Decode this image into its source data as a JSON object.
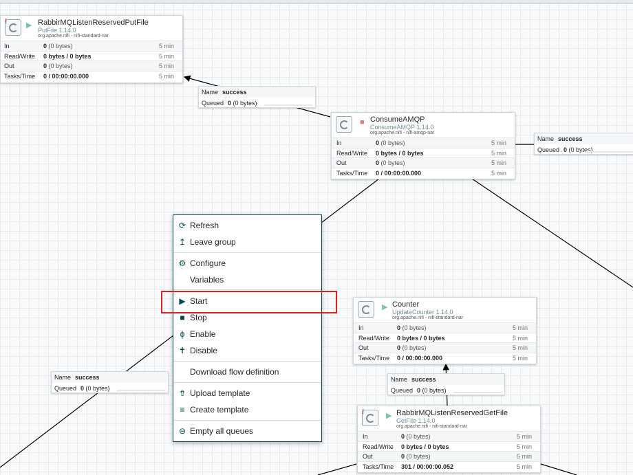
{
  "processors": {
    "putfile": {
      "name": "RabbirMQListenReservedPutFile",
      "type": "PutFile 1.14.0",
      "bundle": "org.apache.nifi - nifi-standard-nar",
      "state": "running",
      "rows": [
        {
          "label": "In",
          "value": "0",
          "unit": "(0 bytes)",
          "time": "5 min"
        },
        {
          "label": "Read/Write",
          "value": "0 bytes / 0 bytes",
          "unit": "",
          "time": "5 min"
        },
        {
          "label": "Out",
          "value": "0",
          "unit": "(0 bytes)",
          "time": "5 min"
        },
        {
          "label": "Tasks/Time",
          "value": "0 / 00:00:00.000",
          "unit": "",
          "time": "5 min"
        }
      ]
    },
    "consumeamqp": {
      "name": "ConsumeAMQP",
      "type": "ConsumeAMQP 1.14.0",
      "bundle": "org.apache.nifi - nifi-amqp-nar",
      "state": "stopped",
      "rows": [
        {
          "label": "In",
          "value": "0",
          "unit": "(0 bytes)",
          "time": "5 min"
        },
        {
          "label": "Read/Write",
          "value": "0 bytes / 0 bytes",
          "unit": "",
          "time": "5 min"
        },
        {
          "label": "Out",
          "value": "0",
          "unit": "(0 bytes)",
          "time": "5 min"
        },
        {
          "label": "Tasks/Time",
          "value": "0 / 00:00:00.000",
          "unit": "",
          "time": "5 min"
        }
      ]
    },
    "counter": {
      "name": "Counter",
      "type": "UpdateCounter 1.14.0",
      "bundle": "org.apache.nifi - nifi-standard-nar",
      "state": "running",
      "rows": [
        {
          "label": "In",
          "value": "0",
          "unit": "(0 bytes)",
          "time": "5 min"
        },
        {
          "label": "Read/Write",
          "value": "0 bytes / 0 bytes",
          "unit": "",
          "time": "5 min"
        },
        {
          "label": "Out",
          "value": "0",
          "unit": "(0 bytes)",
          "time": "5 min"
        },
        {
          "label": "Tasks/Time",
          "value": "0 / 00:00:00.000",
          "unit": "",
          "time": "5 min"
        }
      ]
    },
    "getfile": {
      "name": "RabbirMQListenReservedGetFile",
      "type": "GetFile 1.14.0",
      "bundle": "org.apache.nifi - nifi-standard-nar",
      "state": "running",
      "rows": [
        {
          "label": "In",
          "value": "0",
          "unit": "(0 bytes)",
          "time": "5 min"
        },
        {
          "label": "Read/Write",
          "value": "0 bytes / 0 bytes",
          "unit": "",
          "time": "5 min"
        },
        {
          "label": "Out",
          "value": "0",
          "unit": "(0 bytes)",
          "time": "5 min"
        },
        {
          "label": "Tasks/Time",
          "value": "301 / 00:00:00.052",
          "unit": "",
          "time": "5 min"
        }
      ]
    }
  },
  "connections": {
    "c1": {
      "name_label": "Name",
      "name": "success",
      "queued_label": "Queued",
      "queued": "0",
      "queued_unit": "(0 bytes)"
    },
    "c2": {
      "name_label": "Name",
      "name": "success",
      "queued_label": "Queued",
      "queued": "0",
      "queued_unit": "(0 bytes)"
    },
    "c3": {
      "name_label": "Name",
      "name": "success",
      "queued_label": "Queued",
      "queued": "0",
      "queued_unit": "(0 bytes)"
    },
    "c4": {
      "name_label": "Name",
      "name": "success",
      "queued_label": "Queued",
      "queued": "0",
      "queued_unit": "(0 bytes)"
    }
  },
  "context_menu": {
    "items": [
      {
        "label": "Refresh",
        "icon": "refresh-icon"
      },
      {
        "label": "Leave group",
        "icon": "leave-group-icon"
      },
      {
        "label": "Configure",
        "icon": "gear-icon"
      },
      {
        "label": "Variables",
        "icon": ""
      },
      {
        "label": "Start",
        "icon": "play-icon"
      },
      {
        "label": "Stop",
        "icon": "stop-icon"
      },
      {
        "label": "Enable",
        "icon": "enable-icon"
      },
      {
        "label": "Disable",
        "icon": "disable-icon"
      },
      {
        "label": "Download flow definition",
        "icon": ""
      },
      {
        "label": "Upload template",
        "icon": "upload-template-icon"
      },
      {
        "label": "Create template",
        "icon": "create-template-icon"
      },
      {
        "label": "Empty all queues",
        "icon": "empty-queues-icon"
      }
    ]
  },
  "colors": {
    "running": "#7dc7a0",
    "stopped": "#d18686",
    "accent": "#004849",
    "highlight": "#e02020"
  }
}
